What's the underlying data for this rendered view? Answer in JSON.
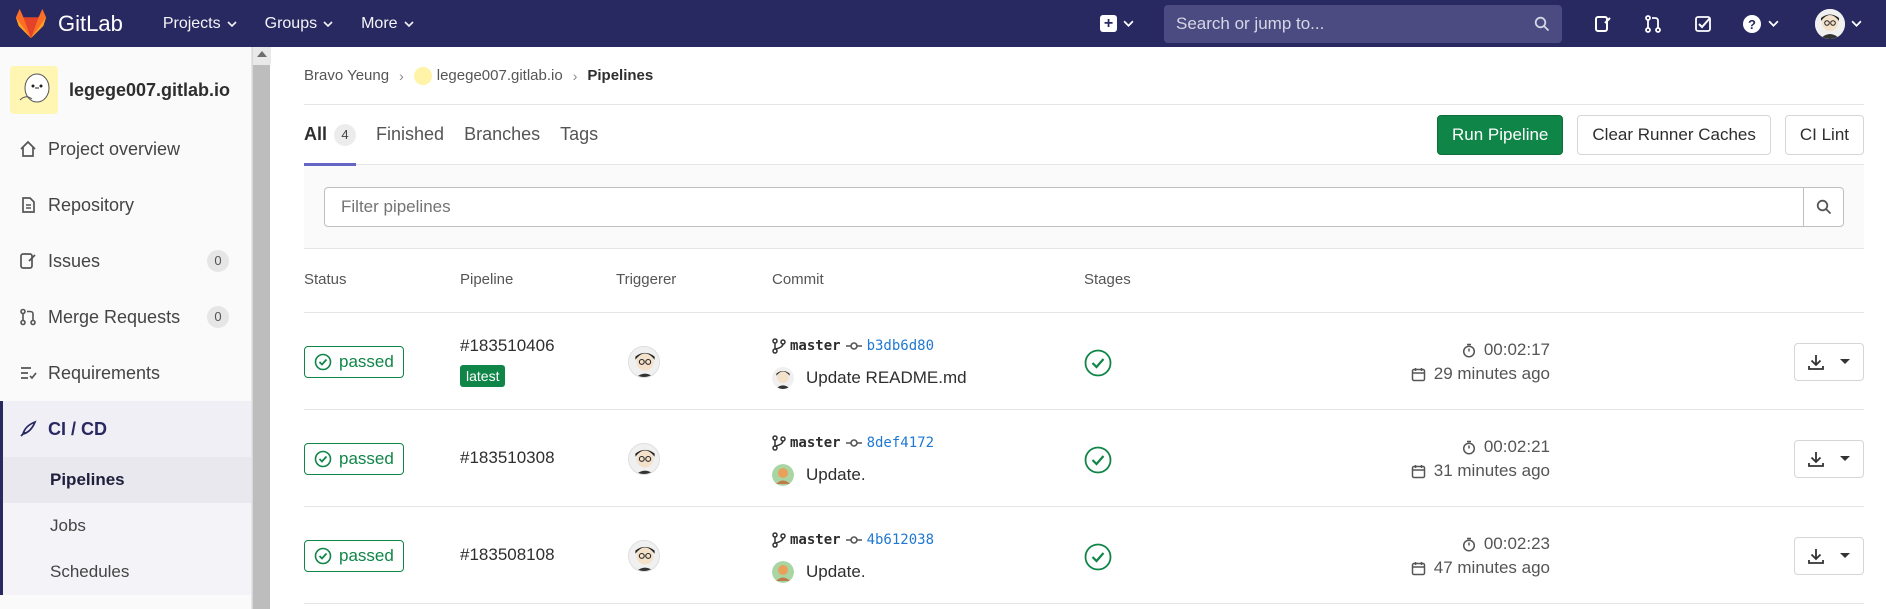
{
  "topbar": {
    "brand": "GitLab",
    "nav": [
      {
        "label": "Projects"
      },
      {
        "label": "Groups"
      },
      {
        "label": "More"
      }
    ],
    "search_placeholder": "Search or jump to...",
    "colors": {
      "bg": "#292961",
      "search_bg": "#4b4b82"
    }
  },
  "sidebar": {
    "project_name": "legege007.gitlab.io",
    "items": [
      {
        "label": "Project overview",
        "icon": "home-icon"
      },
      {
        "label": "Repository",
        "icon": "document-icon"
      },
      {
        "label": "Issues",
        "icon": "issues-icon",
        "count": "0"
      },
      {
        "label": "Merge Requests",
        "icon": "merge-request-icon",
        "count": "0"
      },
      {
        "label": "Requirements",
        "icon": "requirements-icon"
      },
      {
        "label": "CI / CD",
        "icon": "rocket-icon",
        "active": true
      }
    ],
    "subitems": [
      {
        "label": "Pipelines",
        "current": true
      },
      {
        "label": "Jobs"
      },
      {
        "label": "Schedules"
      }
    ]
  },
  "breadcrumb": {
    "owner": "Bravo Yeung",
    "project": "legege007.gitlab.io",
    "current": "Pipelines"
  },
  "tabs": [
    {
      "label": "All",
      "count": "4",
      "active": true
    },
    {
      "label": "Finished"
    },
    {
      "label": "Branches"
    },
    {
      "label": "Tags"
    }
  ],
  "actions": {
    "run": "Run Pipeline",
    "clear": "Clear Runner Caches",
    "lint": "CI Lint"
  },
  "filter_placeholder": "Filter pipelines",
  "columns": [
    "Status",
    "Pipeline",
    "Triggerer",
    "Commit",
    "Stages"
  ],
  "pipelines": [
    {
      "status": "passed",
      "id": "#183510406",
      "badge": "latest",
      "branch": "master",
      "sha": "b3db6d80",
      "message": "Update README.md",
      "duration": "00:02:17",
      "finished": "29 minutes ago"
    },
    {
      "status": "passed",
      "id": "#183510308",
      "branch": "master",
      "sha": "8def4172",
      "message": "Update.",
      "duration": "00:02:21",
      "finished": "31 minutes ago"
    },
    {
      "status": "passed",
      "id": "#183508108",
      "branch": "master",
      "sha": "4b612038",
      "message": "Update.",
      "duration": "00:02:23",
      "finished": "47 minutes ago"
    }
  ],
  "colors": {
    "success": "#108548",
    "accent": "#6666c4",
    "link": "#1f78d1"
  }
}
